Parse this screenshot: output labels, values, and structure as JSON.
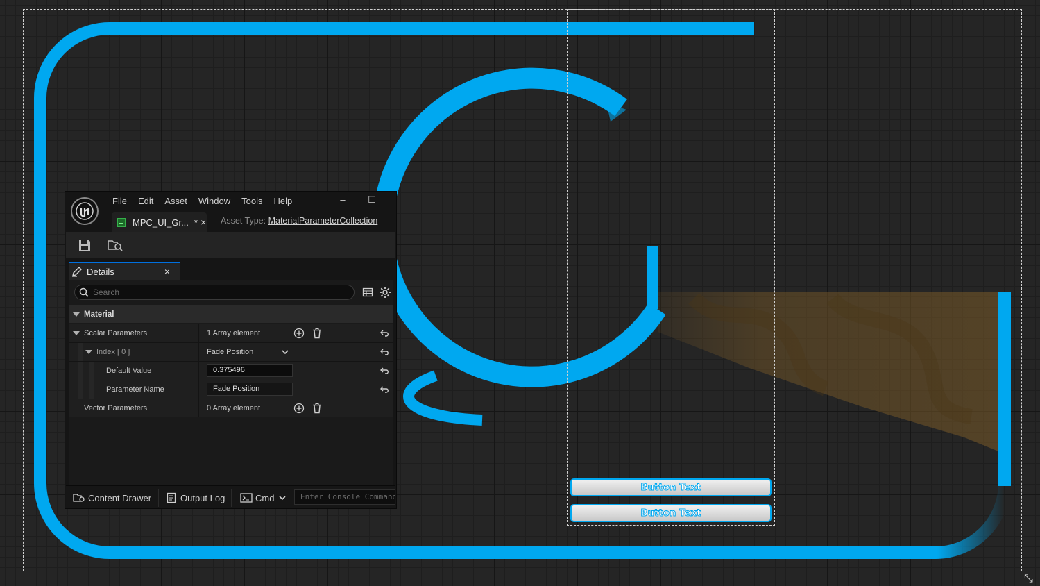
{
  "editor": {
    "menu": [
      "File",
      "Edit",
      "Asset",
      "Window",
      "Tools",
      "Help"
    ],
    "window_buttons": {
      "minimize": "–",
      "maximize": "☐"
    },
    "asset_tab": {
      "label": "MPC_UI_Gr...",
      "modified_marker": "*",
      "close": "×"
    },
    "asset_type": {
      "label": "Asset Type:",
      "value": "MaterialParameterCollection"
    },
    "toolbar": {
      "icons": [
        "save-icon",
        "browse-to-asset-icon"
      ]
    }
  },
  "details": {
    "tab_label": "Details",
    "close": "×",
    "search_placeholder": "Search",
    "category": "Material",
    "scalar_params": {
      "label": "Scalar Parameters",
      "value": "1 Array element"
    },
    "index_row": {
      "label": "Index [ 0 ]",
      "value": "Fade Position"
    },
    "default_value": {
      "label": "Default Value",
      "value": "0.375496"
    },
    "parameter_name": {
      "label": "Parameter Name",
      "value": "Fade Position"
    },
    "vector_params": {
      "label": "Vector Parameters",
      "value": "0 Array element"
    }
  },
  "status_bar": {
    "content_drawer": "Content Drawer",
    "output_log": "Output Log",
    "cmd": "Cmd",
    "console_placeholder": "Enter Console Command"
  },
  "canvas": {
    "buttons": [
      "Button Text",
      "Button Text"
    ],
    "accent_color": "#00a8f0",
    "gradient_fill_color": "#7a5a28"
  }
}
